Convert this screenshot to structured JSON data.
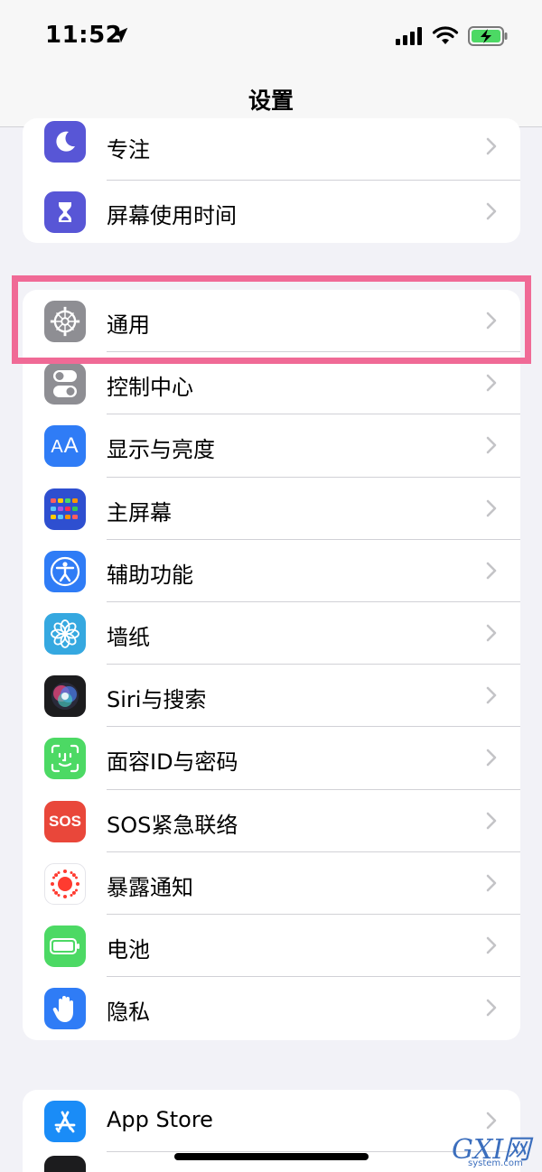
{
  "status": {
    "time": "11:52"
  },
  "nav": {
    "title": "设置"
  },
  "groups": {
    "top": [
      {
        "label": "专注",
        "icon": "moon-icon",
        "color": "#5856d6"
      },
      {
        "label": "屏幕使用时间",
        "icon": "hourglass-icon",
        "color": "#5856d6"
      }
    ],
    "main": [
      {
        "label": "通用",
        "icon": "gear-icon",
        "color": "#8e8e93"
      },
      {
        "label": "控制中心",
        "icon": "toggles-icon",
        "color": "#8e8e93"
      },
      {
        "label": "显示与亮度",
        "icon": "text-size-icon",
        "color": "#2f7cf6"
      },
      {
        "label": "主屏幕",
        "icon": "home-grid-icon",
        "color": "#2e4fd0"
      },
      {
        "label": "辅助功能",
        "icon": "accessibility-icon",
        "color": "#2f7cf6"
      },
      {
        "label": "墙纸",
        "icon": "flower-icon",
        "color": "#35a8e0"
      },
      {
        "label": "Siri与搜索",
        "icon": "siri-icon",
        "color": "#1c1c1e"
      },
      {
        "label": "面容ID与密码",
        "icon": "face-id-icon",
        "color": "#4cd964"
      },
      {
        "label": "SOS紧急联络",
        "icon": "sos-icon",
        "color": "#e9473a",
        "icon_text": "SOS"
      },
      {
        "label": "暴露通知",
        "icon": "exposure-icon",
        "color": "#ffffff"
      },
      {
        "label": "电池",
        "icon": "battery-icon",
        "color": "#4cd964"
      },
      {
        "label": "隐私",
        "icon": "hand-icon",
        "color": "#2f7cf6"
      }
    ],
    "bottom": [
      {
        "label": "App Store",
        "icon": "app-store-icon",
        "color": "#1a8cf7"
      }
    ]
  },
  "watermark": {
    "main": "GXI网",
    "sub": "system.com"
  }
}
